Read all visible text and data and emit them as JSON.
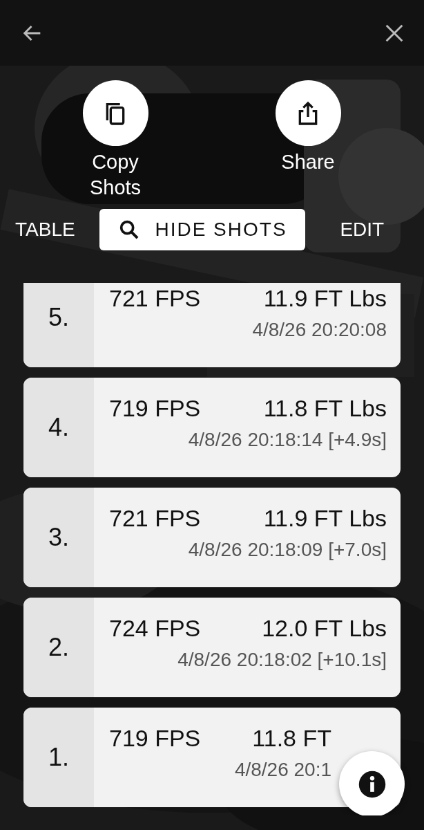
{
  "actions": [
    {
      "label": "Copy Shots",
      "kind": "copy"
    },
    {
      "label": "Share",
      "kind": "share"
    }
  ],
  "toolbar": [
    {
      "label": "TABLE",
      "kind": "text"
    },
    {
      "label": "HIDE SHOTS",
      "kind": "filled"
    },
    {
      "label": "EDIT",
      "kind": "text"
    }
  ],
  "shots": [
    {
      "number": "5.",
      "velocity": "721 FPS",
      "energy": "11.9 FT Lbs",
      "time": "4/8/26 20:20:08"
    },
    {
      "number": "4.",
      "velocity": "719 FPS",
      "energy": "11.8 FT Lbs",
      "time": "4/8/26 20:18:14 [+4.9s]"
    },
    {
      "number": "3.",
      "velocity": "721 FPS",
      "energy": "11.9 FT Lbs",
      "time": "4/8/26 20:18:09 [+7.0s]"
    },
    {
      "number": "2.",
      "velocity": "724 FPS",
      "energy": "12.0 FT Lbs",
      "time": "4/8/26 20:18:02 [+10.1s]"
    },
    {
      "number": "1.",
      "velocity": "719 FPS",
      "energy": "11.8 FT",
      "time": "4/8/26 20:1"
    }
  ]
}
